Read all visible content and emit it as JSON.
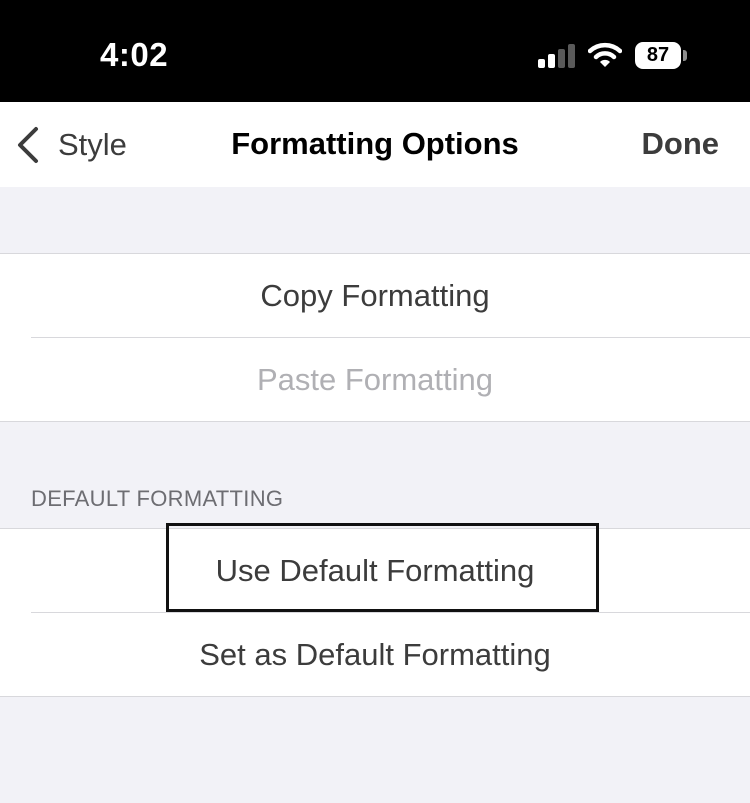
{
  "status_bar": {
    "time": "4:02",
    "battery": "87",
    "icons": [
      "signal-icon",
      "wifi-icon",
      "battery-icon"
    ]
  },
  "nav": {
    "back_label": "Style",
    "title": "Formatting Options",
    "done_label": "Done"
  },
  "groups": {
    "clipboard": {
      "copy": "Copy Formatting",
      "paste": "Paste Formatting"
    },
    "default": {
      "header": "DEFAULT FORMATTING",
      "use_default": "Use Default Formatting",
      "set_default": "Set as Default Formatting"
    }
  },
  "colors": {
    "background": "#f2f2f7",
    "text": "#3c3c3c",
    "disabled_text": "#b0b0b4",
    "header_text": "#6d6d72"
  }
}
